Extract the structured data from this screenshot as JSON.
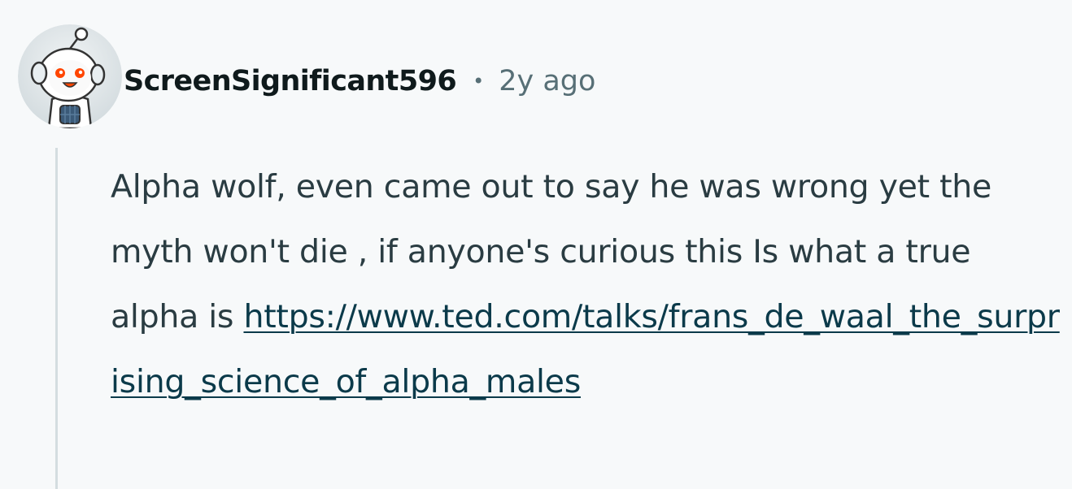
{
  "comment": {
    "author": "ScreenSignificant596",
    "separator": "•",
    "timestamp": "2y ago",
    "text": "Alpha wolf, even came out to say he was wrong yet the myth won't die , if anyone's curious this Is what a true alpha is",
    "link_text": "https://www.ted.com/talks/frans_de_waal_the_surprising_science_of_alpha_males"
  },
  "avatar": {
    "icon": "snoo-avatar-icon",
    "background_color": "#dfe5e8",
    "accent_color": "#ff4500"
  },
  "colors": {
    "page_background": "#f7f9fa",
    "username": "#0f1a1c",
    "meta": "#576f76",
    "body_text": "#2a3c42",
    "link": "#0b3a4a",
    "thread_line": "#d4dde0"
  }
}
